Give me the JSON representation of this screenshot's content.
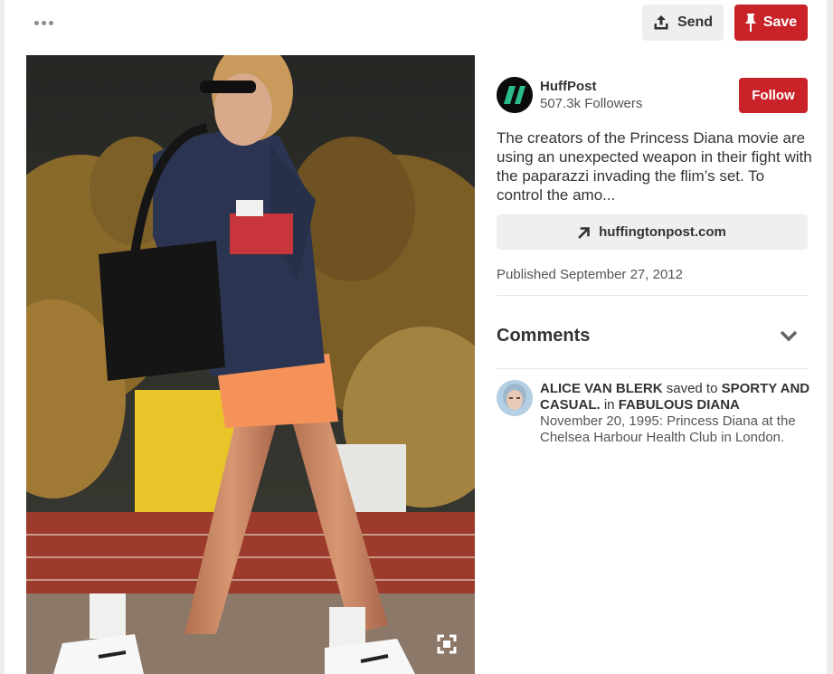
{
  "toolbar": {
    "more_icon": "more-horizontal-icon",
    "send_label": "Send",
    "send_icon": "upload-share-icon",
    "save_label": "Save",
    "save_icon": "pushpin-icon"
  },
  "colors": {
    "accent": "#c92228",
    "neutral_button": "#efefef",
    "text": "#333333"
  },
  "pin": {
    "image_alt": "Princess Diana walking in a navy sweatshirt and orange cycling shorts",
    "expand_icon": "fullscreen-corners-icon"
  },
  "publisher": {
    "name": "HuffPost",
    "followers": "507.3k Followers",
    "follow_label": "Follow"
  },
  "description": "The creators of the Princess Diana movie are using an unexpected weapon in their fight with the paparazzi invading the flim’s set. To control the amo...",
  "link": {
    "label": "huffingtonpost.com",
    "icon": "arrow-up-right-icon"
  },
  "published": "Published September 27, 2012",
  "comments": {
    "title": "Comments",
    "toggle_icon": "chevron-down-icon"
  },
  "activity": {
    "user": "ALICE VAN BLERK",
    "saved_to_text": "saved to",
    "board": "SPORTY AND CASUAL.",
    "in_text": "in",
    "collection": "FABULOUS DIANA",
    "note": "November 20, 1995: Princess Diana at the Chelsea Harbour Health Club in London."
  }
}
